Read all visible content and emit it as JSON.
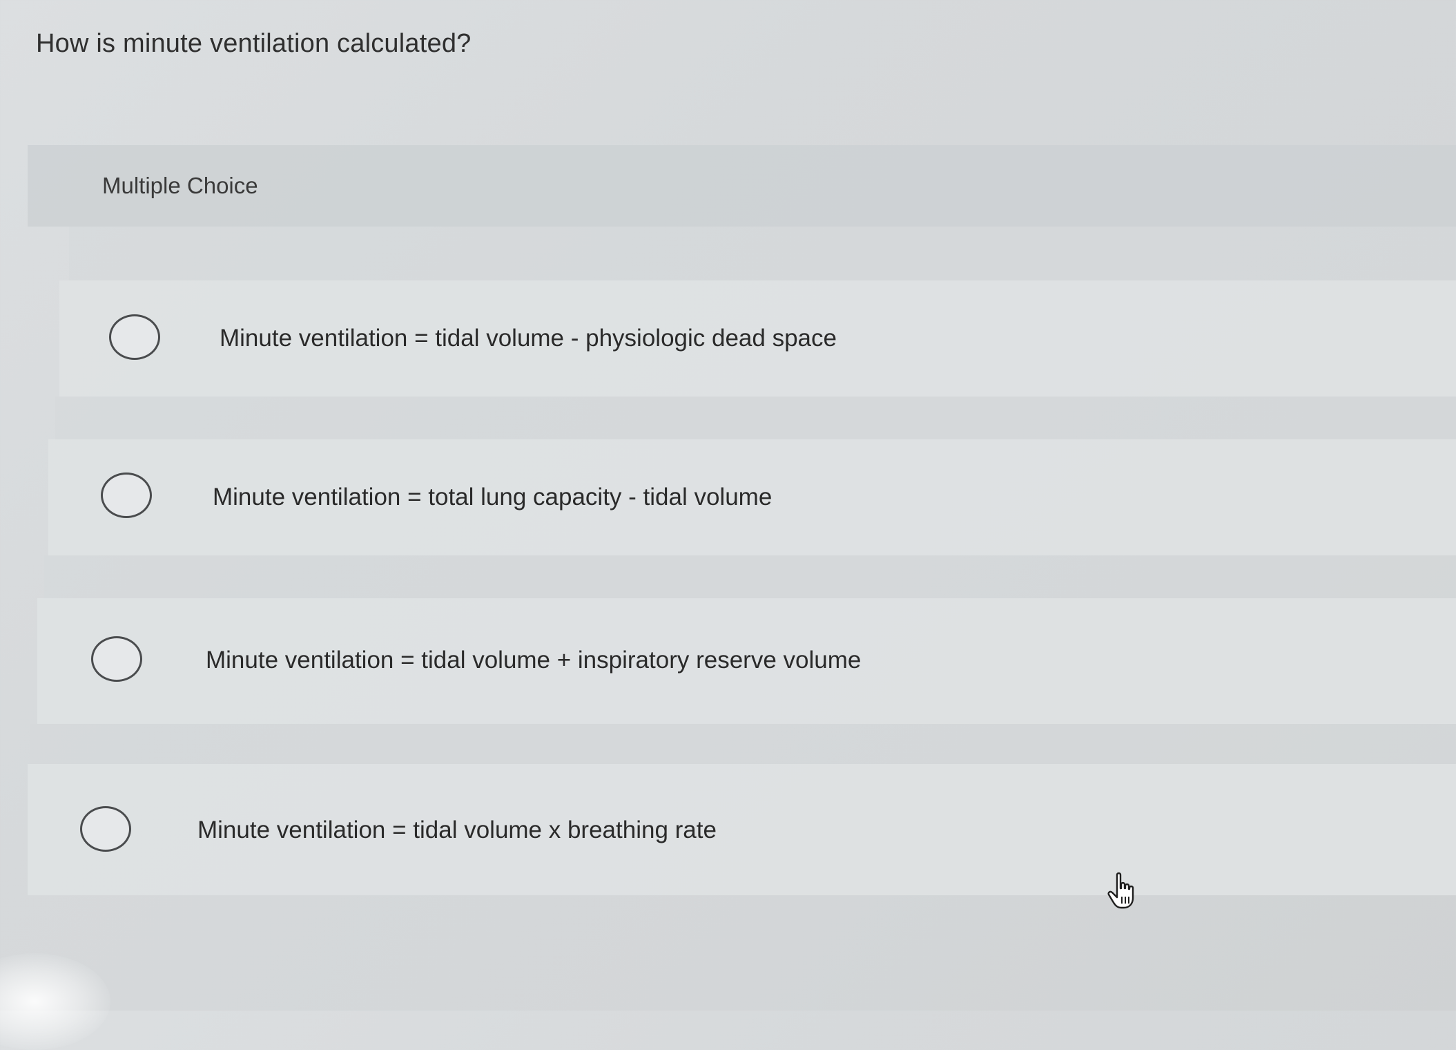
{
  "question": {
    "text": "How is minute ventilation calculated?"
  },
  "section": {
    "label": "Multiple Choice"
  },
  "options": [
    {
      "label": "Minute ventilation = tidal volume - physiologic dead space",
      "selected": false
    },
    {
      "label": "Minute ventilation = total lung capacity - tidal volume",
      "selected": false
    },
    {
      "label": "Minute ventilation = tidal volume + inspiratory reserve volume",
      "selected": false
    },
    {
      "label": "Minute ventilation = tidal volume x breathing rate",
      "selected": false
    }
  ],
  "cursor": {
    "icon": "hand-pointer-icon"
  }
}
